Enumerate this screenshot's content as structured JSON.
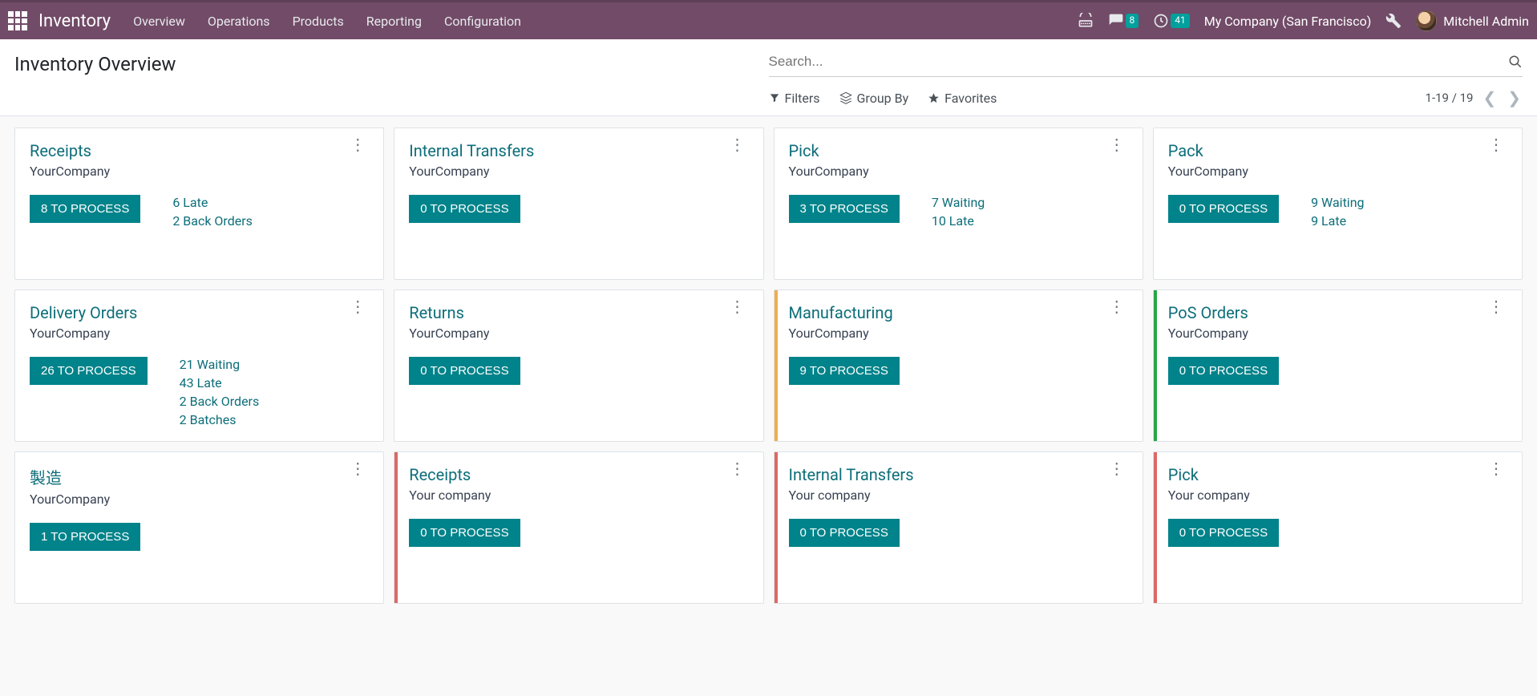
{
  "navbar": {
    "brand": "Inventory",
    "menu": [
      "Overview",
      "Operations",
      "Products",
      "Reporting",
      "Configuration"
    ],
    "messages_badge": "8",
    "activities_badge": "41",
    "company": "My Company (San Francisco)",
    "user": "Mitchell Admin"
  },
  "control": {
    "title": "Inventory Overview",
    "search_placeholder": "Search...",
    "filters_label": "Filters",
    "groupby_label": "Group By",
    "favorites_label": "Favorites",
    "pager": "1-19 / 19"
  },
  "cards": [
    {
      "title": "Receipts",
      "company": "YourCompany",
      "process": "8 TO PROCESS",
      "stats": [
        "6 Late",
        "2 Back Orders"
      ],
      "stripe": ""
    },
    {
      "title": "Internal Transfers",
      "company": "YourCompany",
      "process": "0 TO PROCESS",
      "stats": [],
      "stripe": ""
    },
    {
      "title": "Pick",
      "company": "YourCompany",
      "process": "3 TO PROCESS",
      "stats": [
        "7 Waiting",
        "10 Late"
      ],
      "stripe": ""
    },
    {
      "title": "Pack",
      "company": "YourCompany",
      "process": "0 TO PROCESS",
      "stats": [
        "9 Waiting",
        "9 Late"
      ],
      "stripe": ""
    },
    {
      "title": "Delivery Orders",
      "company": "YourCompany",
      "process": "26 TO PROCESS",
      "stats": [
        "21 Waiting",
        "43 Late",
        "2 Back Orders",
        "2 Batches"
      ],
      "stripe": ""
    },
    {
      "title": "Returns",
      "company": "YourCompany",
      "process": "0 TO PROCESS",
      "stats": [],
      "stripe": ""
    },
    {
      "title": "Manufacturing",
      "company": "YourCompany",
      "process": "9 TO PROCESS",
      "stats": [],
      "stripe": "orange"
    },
    {
      "title": "PoS Orders",
      "company": "YourCompany",
      "process": "0 TO PROCESS",
      "stats": [],
      "stripe": "green"
    },
    {
      "title": "製造",
      "company": "YourCompany",
      "process": "1 TO PROCESS",
      "stats": [],
      "stripe": ""
    },
    {
      "title": "Receipts",
      "company": "Your company",
      "process": "0 TO PROCESS",
      "stats": [],
      "stripe": "red"
    },
    {
      "title": "Internal Transfers",
      "company": "Your company",
      "process": "0 TO PROCESS",
      "stats": [],
      "stripe": "red"
    },
    {
      "title": "Pick",
      "company": "Your company",
      "process": "0 TO PROCESS",
      "stats": [],
      "stripe": "red"
    }
  ]
}
